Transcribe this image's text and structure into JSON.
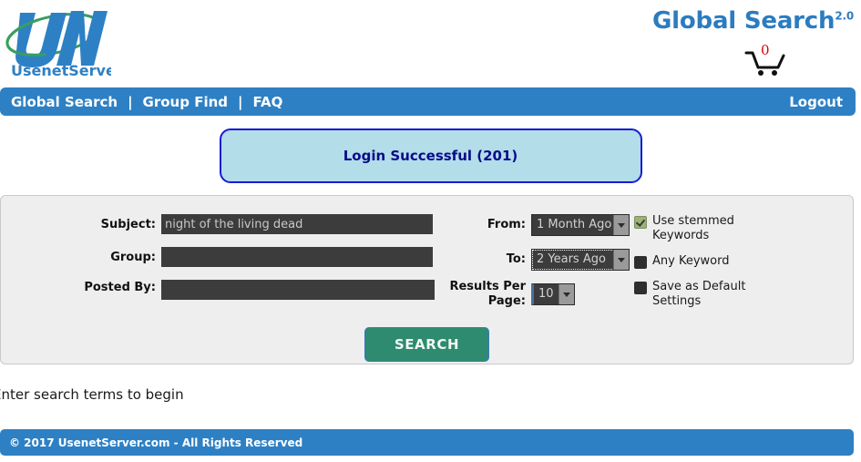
{
  "header": {
    "logo_alt": "UsenetServer",
    "logo_mark": "UNS",
    "logo_wordmark": "UsenetServer",
    "brand_title": "Global Search",
    "brand_version": "2.0",
    "cart_count": "0",
    "cart_icon": "shopping-cart-icon"
  },
  "nav": {
    "items": [
      {
        "label": "Global Search"
      },
      {
        "label": "Group Find"
      },
      {
        "label": "FAQ"
      }
    ],
    "separator": "|",
    "logout_label": "Logout"
  },
  "status": {
    "message": "Login Successful (201)"
  },
  "form": {
    "fields": {
      "subject_label": "Subject:",
      "subject_value": "night of the living dead",
      "group_label": "Group:",
      "group_value": "",
      "posted_by_label": "Posted By:",
      "posted_by_value": ""
    },
    "filters": {
      "from_label": "From:",
      "from_value": "1 Month Ago",
      "to_label": "To:",
      "to_value": "2 Years Ago",
      "results_per_page_label": "Results Per Page:",
      "results_per_page_value": "10"
    },
    "options": [
      {
        "label": "Use stemmed Keywords",
        "checked": true
      },
      {
        "label": "Any Keyword",
        "checked": false
      },
      {
        "label": "Save as Default Settings",
        "checked": false
      }
    ],
    "search_button_label": "SEARCH"
  },
  "hint": {
    "text": "Enter search terms to begin"
  },
  "footer": {
    "copyright": "© 2017 UsenetServer.com - All Rights Reserved"
  },
  "colors": {
    "brand_blue": "#2e80c4",
    "title_blue": "#2b7cc0",
    "status_bg": "#b2dde9",
    "status_border": "#1a1ad6",
    "status_text": "#0a0a8c",
    "panel_bg": "#eeeeee",
    "input_bg": "#3c3c3c",
    "button_green": "#2e8b70",
    "cart_count_red": "#e00000",
    "checkbox_checked": "#9cb377"
  }
}
